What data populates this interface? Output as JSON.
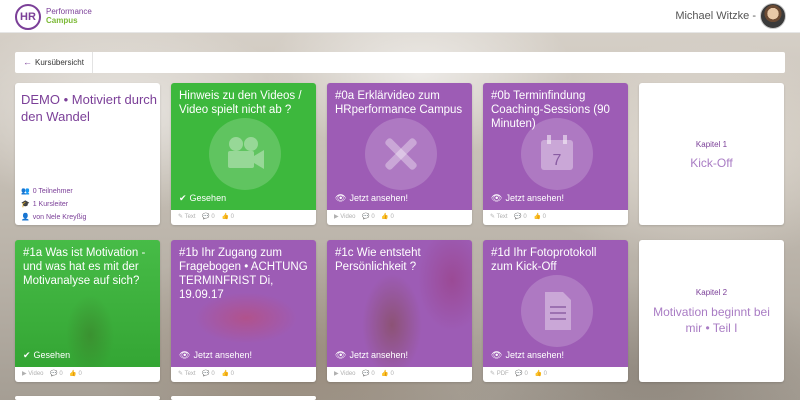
{
  "header": {
    "logo_mark": "HR",
    "logo_line1": "Performance",
    "logo_line2": "Campus",
    "user_name": "Michael Witzke -"
  },
  "breadcrumb": {
    "back_label": "Kursübersicht"
  },
  "intro": {
    "title": "DEMO • Motiviert durch den Wandel",
    "participants": "0 Teilnehmer",
    "leaders": "1 Kursleiter",
    "author": "von Nele Kreyßig"
  },
  "cards": [
    {
      "title": "Hinweis zu den Videos / Video spielt nicht ab ?",
      "status": "Gesehen",
      "type": "Text",
      "comments": "0",
      "likes": "0"
    },
    {
      "title": "#0a Erklärvideo zum HRperformance Campus",
      "status": "Jetzt ansehen!",
      "type": "Video",
      "comments": "0",
      "likes": "0"
    },
    {
      "title": "#0b Terminfindung Coaching-Sessions (90 Minuten)",
      "status": "Jetzt ansehen!",
      "type": "Text",
      "comments": "0",
      "likes": "0"
    },
    {
      "title": "#1a Was ist Motivation - und was hat es mit der Motivanalyse auf sich?",
      "status": "Gesehen",
      "type": "Video",
      "comments": "0",
      "likes": "0"
    },
    {
      "title": "#1b Ihr Zugang zum Fragebogen • ACHTUNG TERMINFRIST Di, 19.09.17",
      "status": "Jetzt ansehen!",
      "type": "Text",
      "comments": "0",
      "likes": "0"
    },
    {
      "title": "#1c Wie entsteht Persönlichkeit ?",
      "status": "Jetzt ansehen!",
      "type": "Video",
      "comments": "0",
      "likes": "0"
    },
    {
      "title": "#1d Ihr Fotoprotokoll zum Kick-Off",
      "status": "Jetzt ansehen!",
      "type": "PDF",
      "comments": "0",
      "likes": "0"
    }
  ],
  "chapters": [
    {
      "label": "Kapitel 1",
      "title": "Kick-Off"
    },
    {
      "label": "Kapitel 2",
      "title": "Motivation beginnt bei mir • Teil I"
    }
  ],
  "icons": {
    "card1": "video-camera-icon",
    "card2": "tools-icon",
    "card3": "calendar-icon",
    "card7": "document-icon"
  },
  "colors": {
    "brand_purple": "#7b3f98",
    "green": "#3db83d",
    "purple_tile": "#9d5cb5"
  }
}
